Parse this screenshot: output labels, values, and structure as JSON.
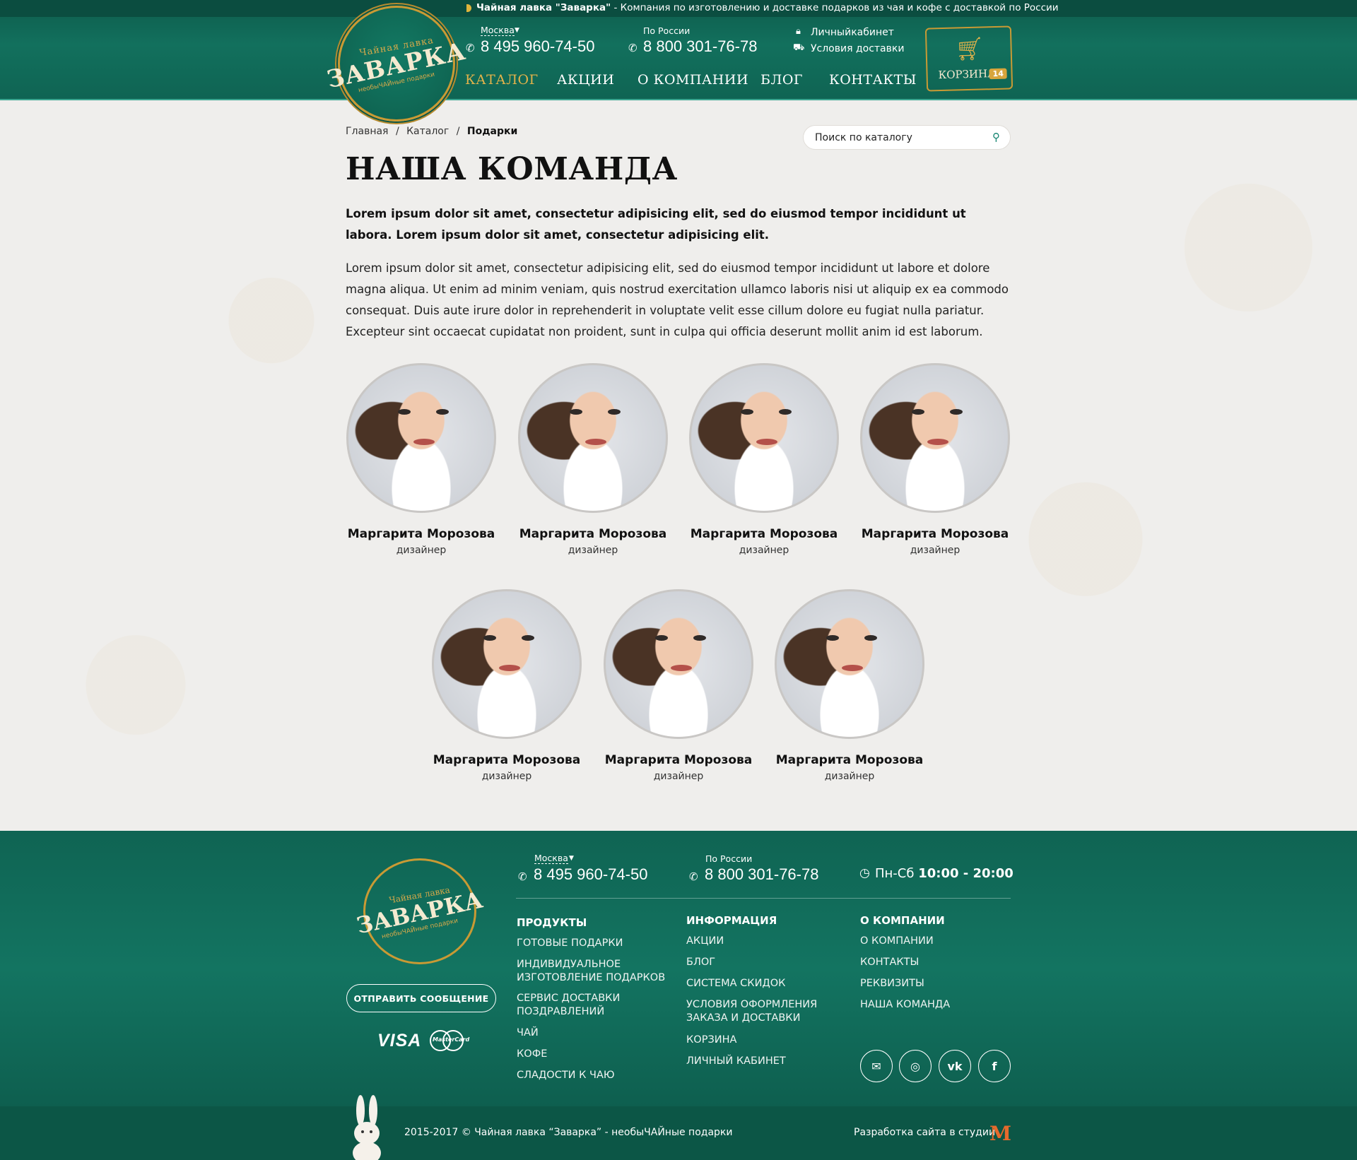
{
  "topbar": {
    "brand": "Чайная лавка \"Заварка\"",
    "text": " - Компания по изготовлению и доставке подарков из чая и кофе с доставкой по России"
  },
  "logo": {
    "top": "Чайная лавка",
    "main": "ЗАВАРКА",
    "sub": "необыЧАЙные подарки"
  },
  "header": {
    "city": "Москва",
    "phone_moscow": "8 495 960-74-50",
    "region_label": "По России",
    "phone_russia": "8 800 301-76-78",
    "cabinet": "Личныйкабинет",
    "delivery": "Условия доставки"
  },
  "nav": [
    {
      "label": "КАТАЛОГ",
      "active": true
    },
    {
      "label": "АКЦИИ"
    },
    {
      "label": "О КОМПАНИИ"
    },
    {
      "label": "БЛОГ"
    },
    {
      "label": "КОНТАКТЫ"
    }
  ],
  "cart": {
    "label": "КОРЗИНА",
    "count": "14"
  },
  "breadcrumb": {
    "home": "Главная",
    "catalog": "Каталог",
    "current": "Подарки"
  },
  "search": {
    "placeholder": "Поиск по каталогу"
  },
  "page": {
    "title": "НАША КОМАНДА",
    "lead": "Lorem ipsum dolor sit amet, consectetur adipisicing elit, sed do eiusmod tempor incididunt ut labora. Lorem ipsum dolor sit amet, consectetur adipisicing elit.",
    "body": "Lorem ipsum dolor sit amet, consectetur adipisicing elit, sed do eiusmod tempor incididunt ut labore et dolore magna aliqua. Ut enim ad minim veniam, quis nostrud exercitation ullamco laboris nisi ut aliquip ex ea commodo consequat. Duis aute irure dolor in reprehenderit in voluptate velit esse cillum dolore eu fugiat nulla pariatur. Excepteur sint occaecat cupidatat non proident, sunt in culpa qui officia deserunt mollit anim id est laborum."
  },
  "team": [
    {
      "name": "Маргарита Морозова",
      "role": "дизайнер"
    },
    {
      "name": "Маргарита Морозова",
      "role": "дизайнер"
    },
    {
      "name": "Маргарита Морозова",
      "role": "дизайнер"
    },
    {
      "name": "Маргарита Морозова",
      "role": "дизайнер"
    },
    {
      "name": "Маргарита Морозова",
      "role": "дизайнер"
    },
    {
      "name": "Маргарита Морозова",
      "role": "дизайнер"
    },
    {
      "name": "Маргарита Морозова",
      "role": "дизайнер"
    }
  ],
  "footer": {
    "city": "Москва",
    "phone_moscow": "8 495 960-74-50",
    "region_label": "По России",
    "phone_russia": "8 800 301-76-78",
    "hours_days": "Пн-Сб ",
    "hours_time": "10:00 - 20:00",
    "send_button": "ОТПРАВИТЬ СООБЩЕНИЕ",
    "visa": "VISA",
    "mastercard": "MasterCard",
    "columns": {
      "products": {
        "title": "ПРОДУКТЫ",
        "links": [
          "ГОТОВЫЕ ПОДАРКИ",
          "ИНДИВИДУАЛЬНОЕ\nИЗГОТОВЛЕНИЕ ПОДАРКОВ",
          "СЕРВИС ДОСТАВКИ\nПОЗДРАВЛЕНИЙ",
          "ЧАЙ",
          "КОФЕ",
          "СЛАДОСТИ К ЧАЮ"
        ]
      },
      "info": {
        "title": "ИНФОРМАЦИЯ",
        "links": [
          "АКЦИИ",
          "БЛОГ",
          "СИСТЕМА СКИДОК",
          "УСЛОВИЯ ОФОРМЛЕНИЯ\nЗАКАЗА И ДОСТАВКИ",
          "КОРЗИНА",
          "ЛИЧНЫЙ КАБИНЕТ"
        ]
      },
      "company": {
        "title": "О КОМПАНИИ",
        "links": [
          "О КОМПАНИИ",
          "КОНТАКТЫ",
          "РЕКВИЗИТЫ",
          "НАША КОМАНДА"
        ]
      }
    },
    "copyright": "2015-2017 © Чайная лавка “Заварка” - необыЧАЙные подарки",
    "developer": "Разработка сайта в студии"
  },
  "colors": {
    "brand_green": "#12705d",
    "accent_gold": "#e2b24a",
    "text_dark": "#111111"
  },
  "icons": [
    "phone-icon",
    "lock-icon",
    "truck-icon",
    "cart-icon",
    "search-icon",
    "clock-icon",
    "mail-icon",
    "instagram-icon",
    "vk-icon",
    "facebook-icon"
  ]
}
